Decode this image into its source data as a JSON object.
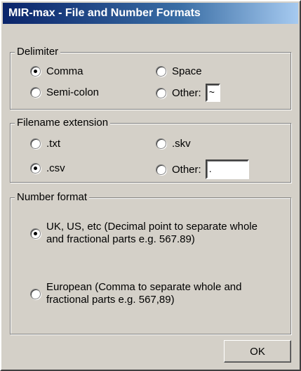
{
  "window": {
    "title": "MIR-max - File and Number Formats"
  },
  "delimiter": {
    "legend": "Delimiter",
    "options": [
      {
        "label": "Comma",
        "checked": true
      },
      {
        "label": "Space",
        "checked": false
      },
      {
        "label": "Semi-colon",
        "checked": false
      },
      {
        "label": "Other:",
        "checked": false
      }
    ],
    "other_value": "~"
  },
  "filename_extension": {
    "legend": "Filename extension",
    "options": [
      {
        "label": ".txt",
        "checked": false
      },
      {
        "label": ".skv",
        "checked": false
      },
      {
        "label": ".csv",
        "checked": true
      },
      {
        "label": "Other:",
        "checked": false
      }
    ],
    "other_value": "."
  },
  "number_format": {
    "legend": "Number format",
    "options": [
      {
        "label": "UK, US, etc (Decimal point to separate whole and fractional parts e.g. 567.89)",
        "checked": true
      },
      {
        "label": "European (Comma to separate whole and fractional parts e.g. 567,89)",
        "checked": false
      }
    ]
  },
  "buttons": {
    "ok_label": "OK"
  }
}
